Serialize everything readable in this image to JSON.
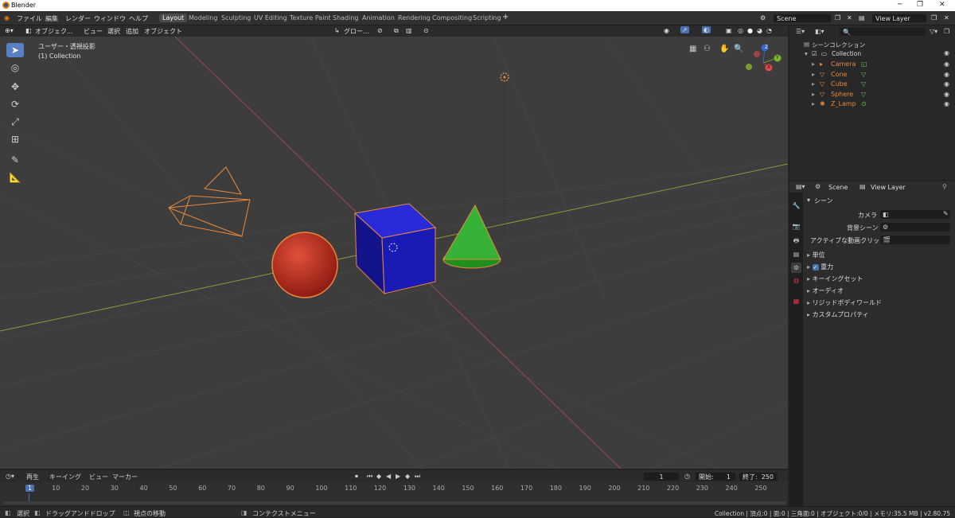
{
  "app": {
    "title": "Blender"
  },
  "menu": [
    "ファイル",
    "編集",
    "レンダー",
    "ウィンドウ",
    "ヘルプ"
  ],
  "workspaces": [
    "Layout",
    "Modeling",
    "Sculpting",
    "UV Editing",
    "Texture Paint",
    "Shading",
    "Animation",
    "Rendering",
    "Compositing",
    "Scripting"
  ],
  "active_workspace": "Layout",
  "scene_field": "Scene",
  "view_layer_field": "View Layer",
  "viewport_header": {
    "mode": "オブジェク...",
    "menus": [
      "ビュー",
      "選択",
      "追加",
      "オブジェクト"
    ],
    "orientation": "グロー..."
  },
  "viewport": {
    "view_name": "ユーザー・透視投影",
    "collection_label": "(1) Collection"
  },
  "gizmo": {
    "x": "X",
    "y": "Y",
    "z": "Z"
  },
  "outliner": {
    "scene_collection": "シーンコレクション",
    "collection": "Collection",
    "items": [
      {
        "name": "Camera",
        "icon": "camera-icon",
        "color": "#e8883b"
      },
      {
        "name": "Cone",
        "icon": "mesh-icon",
        "color": "#e8883b"
      },
      {
        "name": "Cube",
        "icon": "mesh-icon",
        "color": "#e8883b"
      },
      {
        "name": "Sphere",
        "icon": "mesh-icon",
        "color": "#e8883b"
      },
      {
        "name": "Z_Lamp",
        "icon": "lamp-icon",
        "color": "#e8883b"
      }
    ]
  },
  "properties": {
    "breadcrumb_scene": "Scene",
    "breadcrumb_layer": "View Layer",
    "panel_title": "シーン",
    "camera_label": "カメラ",
    "background_label": "背景シーン",
    "clip_label": "アクティブな動画クリップ",
    "sections": [
      "単位",
      "重力",
      "キーイングセット",
      "オーディオ",
      "リジッドボディワールド",
      "カスタムプロパティ"
    ]
  },
  "timeline": {
    "menus": [
      "再生",
      "キーイング",
      "ビュー",
      "マーカー"
    ],
    "current_frame": "1",
    "start_label": "開始:",
    "start": "1",
    "end_label": "終了:",
    "end": "250",
    "ticks": [
      "1",
      "10",
      "20",
      "30",
      "40",
      "50",
      "60",
      "70",
      "80",
      "90",
      "100",
      "110",
      "120",
      "130",
      "140",
      "150",
      "160",
      "170",
      "180",
      "190",
      "200",
      "210",
      "220",
      "230",
      "240",
      "250"
    ]
  },
  "status": {
    "select": "選択",
    "drag": "ドラッグアンドドロップ",
    "move_view": "視点の移動",
    "context_menu": "コンテクストメニュー",
    "stats": "Collection | 頂点:0 | 面:0 | 三角面:0 | オブジェクト:0/0 | メモリ:35.5 MB | v2.80.75"
  },
  "colors": {
    "accent": "#5680c2",
    "selection": "#e8883b",
    "cube": "#1a1aa6",
    "cone": "#2fa52f",
    "sphere": "#b3261b"
  }
}
